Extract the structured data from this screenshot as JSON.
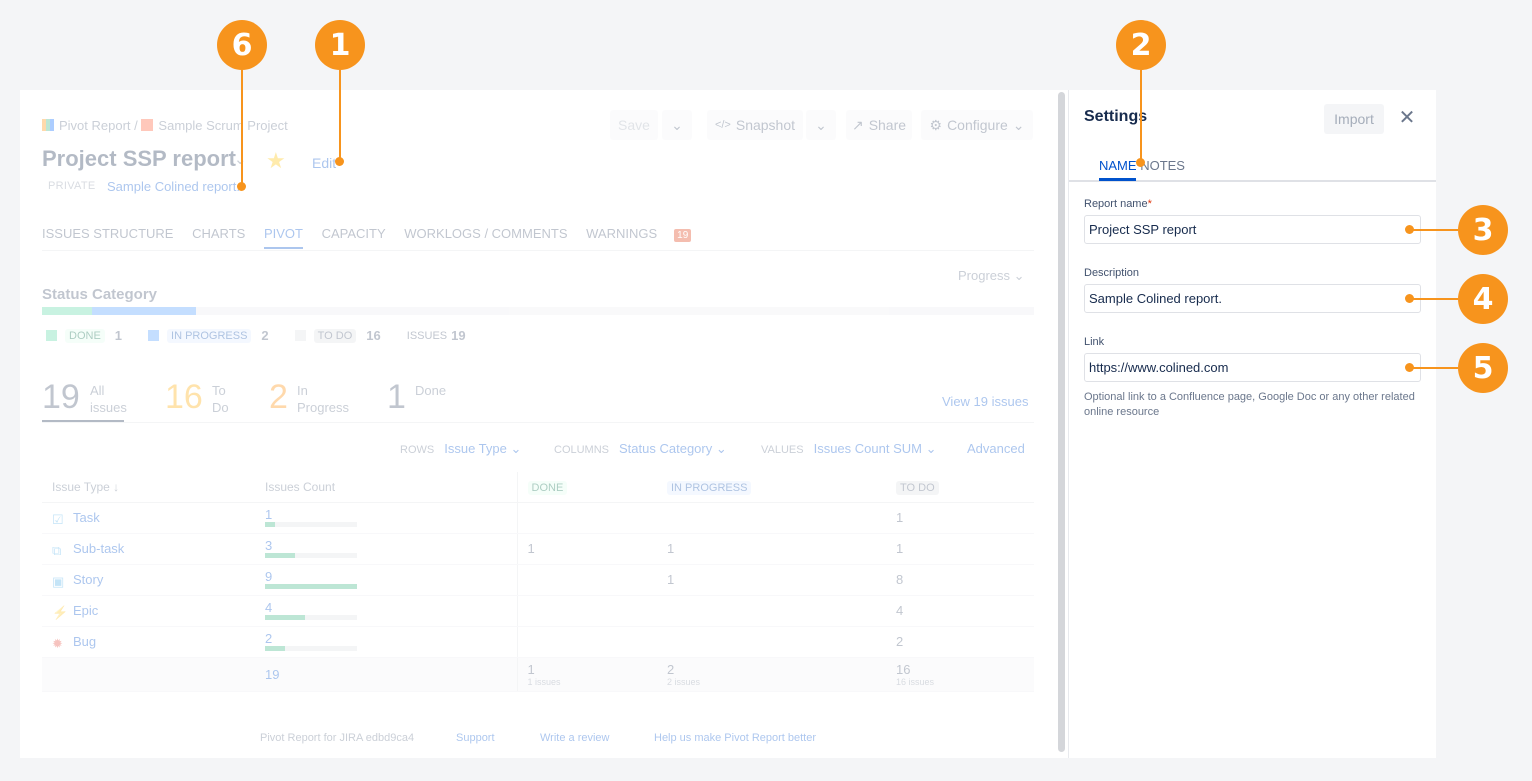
{
  "breadcrumb": {
    "app": "Pivot Report",
    "separator": "/",
    "project": "Sample Scrum Project"
  },
  "header": {
    "title": "Project SSP report",
    "edit_label": "Edit",
    "visibility": "PRIVATE",
    "description": "Sample Colined report."
  },
  "toolbar": {
    "save": "Save",
    "snapshot": "Snapshot",
    "share": "Share",
    "configure": "Configure"
  },
  "tabs": [
    "ISSUES STRUCTURE",
    "CHARTS",
    "PIVOT",
    "CAPACITY",
    "WORKLOGS / COMMENTS",
    "WARNINGS"
  ],
  "warnings_count": "19",
  "progress_dropdown": "Progress",
  "status_category": {
    "title": "Status Category",
    "done_fraction": 0.05,
    "in_progress_fraction": 0.105,
    "legend": [
      {
        "label": "DONE",
        "count": "1",
        "color": "#57d9a3"
      },
      {
        "label": "IN PROGRESS",
        "count": "2",
        "color": "#4c9aff"
      },
      {
        "label": "TO DO",
        "count": "16",
        "color": "#dfe1e6"
      }
    ],
    "issues_label": "ISSUES",
    "issues_count": "19"
  },
  "stats": [
    {
      "num": "19",
      "label1": "All",
      "label2": "issues",
      "color": "#42526e"
    },
    {
      "num": "16",
      "label1": "To",
      "label2": "Do",
      "color": "#ffab00"
    },
    {
      "num": "2",
      "label1": "In",
      "label2": "Progress",
      "color": "#ff8b00"
    },
    {
      "num": "1",
      "label1": "Done",
      "label2": "",
      "color": "#42526e"
    }
  ],
  "view_all": "View 19 issues",
  "controls": {
    "rows_key": "ROWS",
    "rows_val": "Issue Type",
    "columns_key": "COLUMNS",
    "columns_val": "Status Category",
    "values_key": "VALUES",
    "values_val": "Issues Count SUM",
    "advanced": "Advanced"
  },
  "table": {
    "headers": [
      "Issue Type",
      "Issues Count",
      "DONE",
      "IN PROGRESS",
      "TO DO"
    ],
    "rows": [
      {
        "type": "Task",
        "count": "1",
        "fill": 0.11,
        "done": "",
        "inprog": "",
        "todo": "1",
        "icon_color": "#4bade8"
      },
      {
        "type": "Sub-task",
        "count": "3",
        "fill": 0.33,
        "done": "1",
        "inprog": "1",
        "todo": "1",
        "icon_color": "#4bade8"
      },
      {
        "type": "Story",
        "count": "9",
        "fill": 1.0,
        "done": "",
        "inprog": "1",
        "todo": "8",
        "icon_color": "#4bade8"
      },
      {
        "type": "Epic",
        "count": "4",
        "fill": 0.44,
        "done": "",
        "inprog": "",
        "todo": "4",
        "icon_color": "#904ee2"
      },
      {
        "type": "Bug",
        "count": "2",
        "fill": 0.22,
        "done": "",
        "inprog": "",
        "todo": "2",
        "icon_color": "#e5493a"
      }
    ],
    "total": {
      "count": "19",
      "done": "1",
      "done_sub": "1 issues",
      "inprog": "2",
      "inprog_sub": "2 issues",
      "todo": "16",
      "todo_sub": "16 issues"
    }
  },
  "footer": [
    "Pivot Report for JIRA edbd9ca4",
    "Support",
    "Write a review",
    "Help us make Pivot Report better"
  ],
  "settings": {
    "title": "Settings",
    "import": "Import",
    "tab_name": "NAME",
    "tab_notes": "NOTES",
    "report_name_label": "Report name",
    "required_mark": "*",
    "report_name_value": "Project SSP report",
    "description_label": "Description",
    "description_value": "Sample Colined report.",
    "link_label": "Link",
    "link_value": "https://www.colined.com",
    "link_hint": "Optional link to a Confluence page, Google Doc or any other related online resource"
  },
  "callouts": [
    "1",
    "2",
    "3",
    "4",
    "5",
    "6"
  ],
  "colors": {
    "accent": "#f7941d",
    "link": "#0052cc"
  }
}
